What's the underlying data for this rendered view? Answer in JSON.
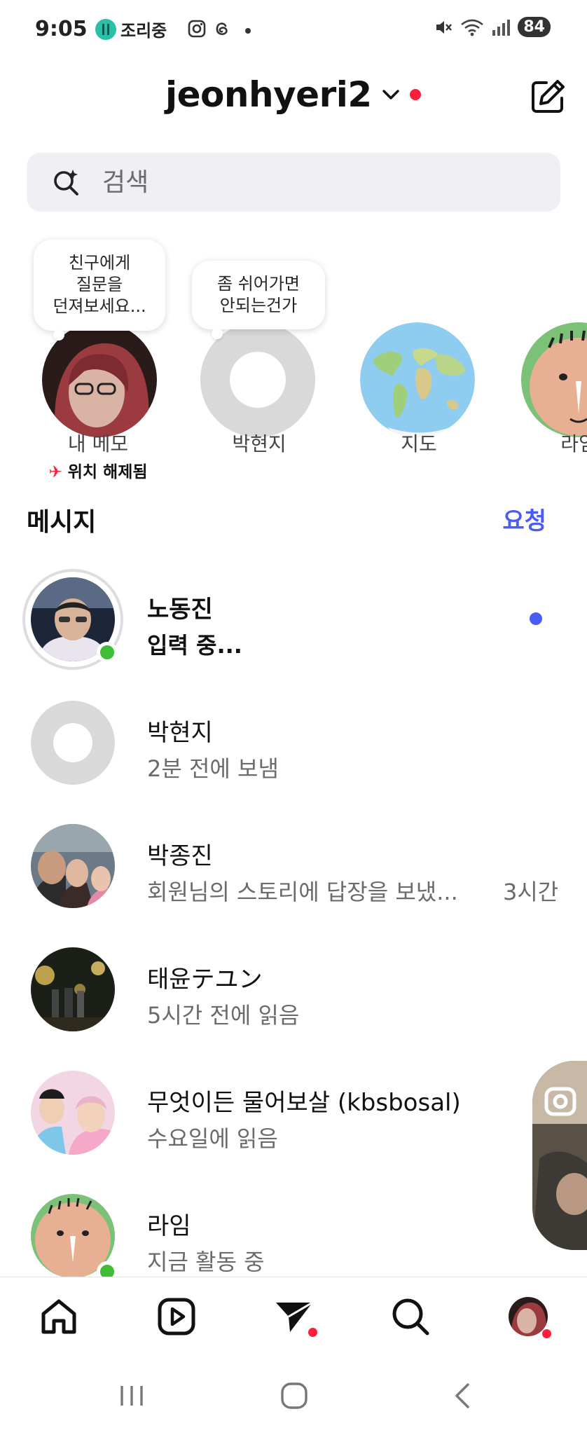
{
  "status_bar": {
    "time": "9:05",
    "app_label": "조리중",
    "battery": "84"
  },
  "header": {
    "account_name": "jeonhyeri2"
  },
  "search": {
    "placeholder": "검색"
  },
  "notes": [
    {
      "bubble": "친구에게\n질문을\n던져보세요...",
      "name": "내 메모",
      "sub": "위치 해제됨"
    },
    {
      "bubble": "좀 쉬어가면\n안되는건가",
      "name": "박현지"
    },
    {
      "name": "지도"
    },
    {
      "name": "라임"
    }
  ],
  "messages": {
    "title": "메시지",
    "requests_label": "요청",
    "conversations": [
      {
        "name": "노동진",
        "sub": "입력 중...",
        "time": "",
        "online": true,
        "unread": true
      },
      {
        "name": "박현지",
        "sub": "2분 전에 보냄",
        "time": "",
        "online": false,
        "unread": false
      },
      {
        "name": "박종진",
        "sub": "회원님의 스토리에 답장을 보냈...",
        "time": "3시간",
        "online": false,
        "unread": false
      },
      {
        "name": "태윤テユン",
        "sub": "5시간 전에 읽음",
        "time": "",
        "online": false,
        "unread": false
      },
      {
        "name": "무엇이든 물어보살 (kbsbosal)",
        "sub": "수요일에 읽음",
        "time": "",
        "online": false,
        "unread": false
      },
      {
        "name": "라임",
        "sub": "지금 활동 중",
        "time": "",
        "online": true,
        "unread": false
      }
    ]
  },
  "colors": {
    "accent_blue": "#4b5bf5",
    "notification_red": "#ff1f3d",
    "online_green": "#3fbd36",
    "search_bg": "#efeff4"
  },
  "icons": {
    "nav": [
      "home-icon",
      "reels-icon",
      "messages-icon",
      "search-icon",
      "profile-avatar"
    ],
    "system": [
      "recent-apps-icon",
      "home-button-icon",
      "back-icon"
    ]
  }
}
